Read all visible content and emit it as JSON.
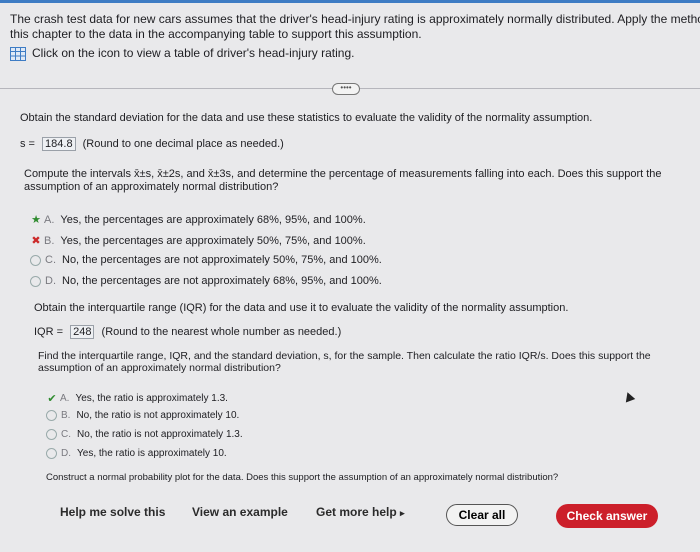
{
  "intro": {
    "line1": "The crash test data for new cars assumes that the driver's head-injury rating is approximately normally distributed. Apply the methods of",
    "line2": "this chapter to the data in the accompanying table to support this assumption.",
    "link": "Click on the icon to view a table of driver's head-injury rating."
  },
  "more_label": "••••",
  "part1": {
    "question": "Obtain the standard deviation for the data and use these statistics to evaluate the validity of the normality assumption.",
    "s_label": "s =",
    "s_value": "184.8",
    "s_hint": "(Round to one decimal place as needed.)"
  },
  "part2": {
    "question_line1": "Compute the intervals x̄±s, x̄±2s, and x̄±3s, and determine the percentage of measurements falling into each. Does this support the",
    "question_line2": "assumption of an approximately normal distribution?",
    "options": [
      {
        "letter": "A.",
        "text": "Yes, the percentages are approximately 68%, 95%, and 100%.",
        "status": "correct"
      },
      {
        "letter": "B.",
        "text": "Yes, the percentages are approximately 50%, 75%, and 100%.",
        "status": "incorrect"
      },
      {
        "letter": "C.",
        "text": "No, the percentages are not approximately 50%, 75%, and 100%.",
        "status": "none"
      },
      {
        "letter": "D.",
        "text": "No, the percentages are not approximately 68%, 95%, and 100%.",
        "status": "none"
      }
    ]
  },
  "part3": {
    "question": "Obtain the interquartile range (IQR) for the data and use it to evaluate the validity of the normality assumption.",
    "iqr_label": "IQR =",
    "iqr_value": "248",
    "iqr_hint": "(Round to the nearest whole number as needed.)"
  },
  "part4": {
    "question_line1": "Find the interquartile range, IQR, and the standard deviation, s, for the sample. Then calculate the ratio IQR/s. Does this support the",
    "question_line2": "assumption of an approximately normal distribution?",
    "options": [
      {
        "letter": "A.",
        "text": "Yes, the ratio is approximately 1.3.",
        "status": "correct"
      },
      {
        "letter": "B.",
        "text": "No, the ratio is not approximately 10.",
        "status": "none"
      },
      {
        "letter": "C.",
        "text": "No, the ratio is not approximately 1.3.",
        "status": "none"
      },
      {
        "letter": "D.",
        "text": "Yes, the ratio is approximately 10.",
        "status": "none"
      }
    ]
  },
  "part5": {
    "question": "Construct a normal probability plot for the data. Does this support the assumption of an approximately normal distribution?"
  },
  "toolbar": {
    "help": "Help me solve this",
    "example": "View an example",
    "more_help": "Get more help",
    "more_help_arrow": "▸",
    "clear": "Clear all",
    "check": "Check answer"
  },
  "colors": {
    "accent": "#3e7cc4",
    "check": "#cc1f2a",
    "correct": "#2e8b2e",
    "incorrect": "#cc2a2a"
  }
}
